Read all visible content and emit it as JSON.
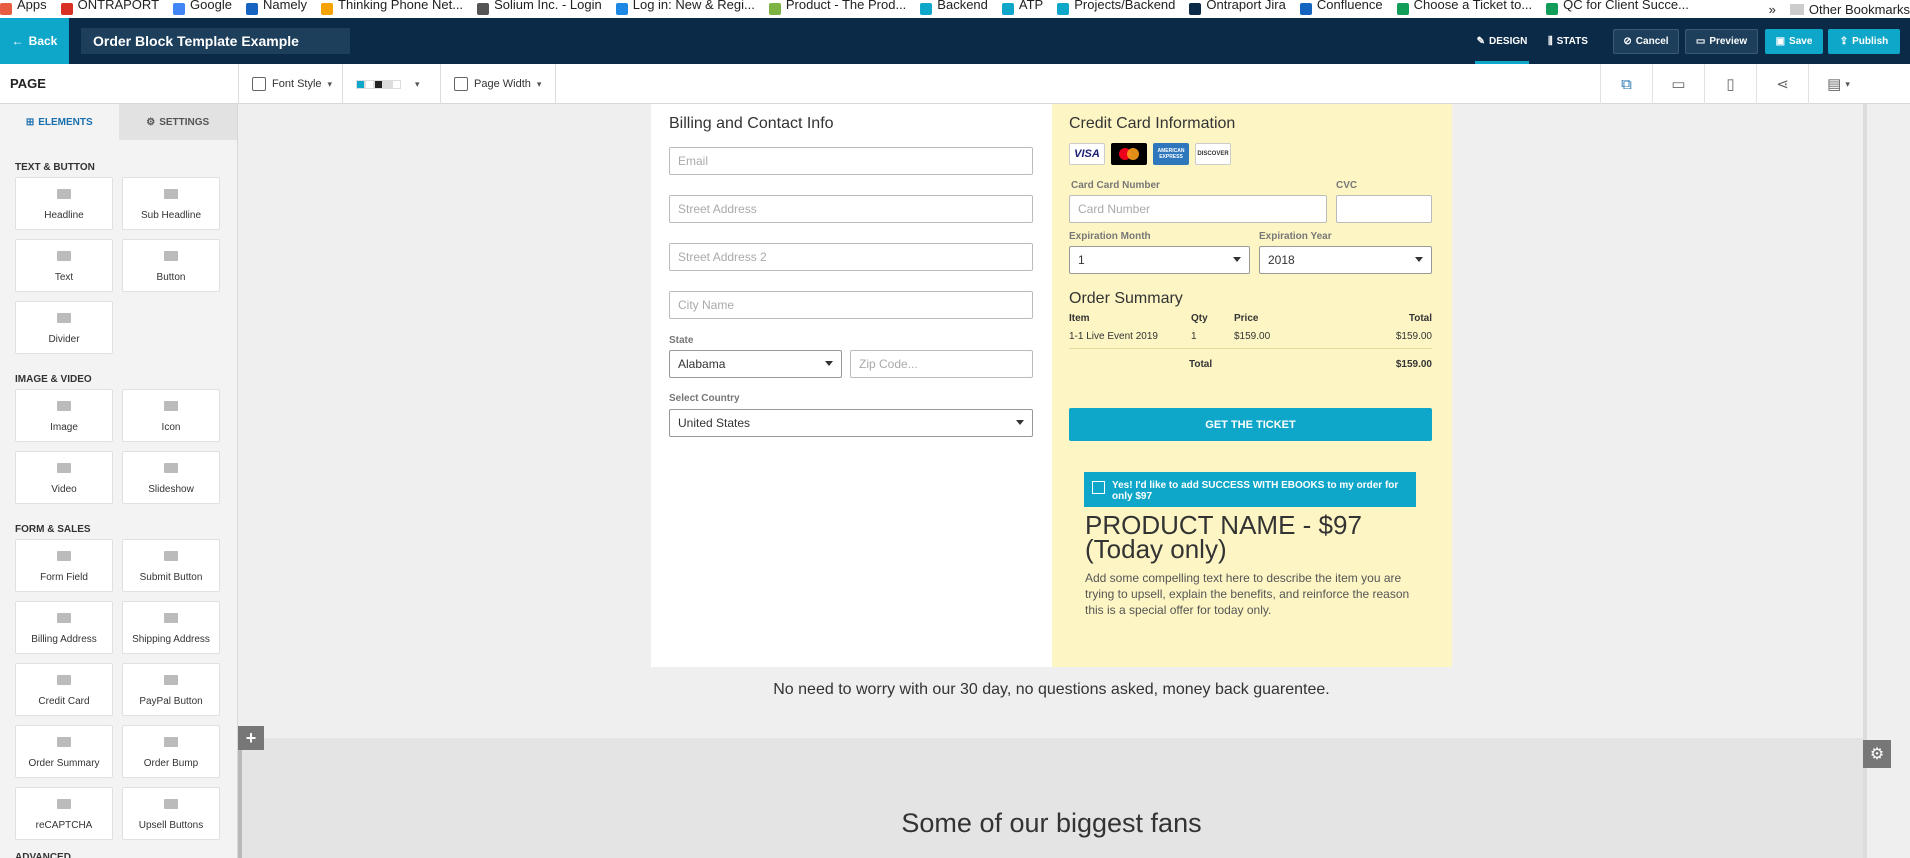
{
  "bookmarks": {
    "items": [
      {
        "label": "Apps",
        "icon": "apps-grid-icon",
        "color": "#e85c41"
      },
      {
        "label": "ONTRAPORT",
        "icon": "gmail-icon",
        "color": "#d93025"
      },
      {
        "label": "Google",
        "icon": "google-icon",
        "color": "#4285f4"
      },
      {
        "label": "Namely",
        "icon": "namely-icon",
        "color": "#1565c0"
      },
      {
        "label": "Thinking Phone Net...",
        "icon": "thinkingphone-icon",
        "color": "#f4a300"
      },
      {
        "label": "Solium Inc. - Login",
        "icon": "solium-icon",
        "color": "#555555"
      },
      {
        "label": "Log in: New & Regi...",
        "icon": "login-icon",
        "color": "#1e88e5"
      },
      {
        "label": "Product - The Prod...",
        "icon": "product-icon",
        "color": "#7cb342"
      },
      {
        "label": "Backend",
        "icon": "backend-icon",
        "color": "#0fa7c9"
      },
      {
        "label": "ATP",
        "icon": "atp-icon",
        "color": "#0fa7c9"
      },
      {
        "label": "Projects/Backend",
        "icon": "projects-icon",
        "color": "#0fa7c9"
      },
      {
        "label": "Ontraport Jira",
        "icon": "jira-icon",
        "color": "#0b2a47"
      },
      {
        "label": "Confluence",
        "icon": "confluence-icon",
        "color": "#1565c0"
      },
      {
        "label": "Choose a Ticket to...",
        "icon": "sheet-icon",
        "color": "#0f9d58"
      },
      {
        "label": "QC for Client Succe...",
        "icon": "sheet-icon",
        "color": "#0f9d58"
      }
    ],
    "more": "»",
    "other": "Other Bookmarks"
  },
  "topbar": {
    "back_label": "Back",
    "page_title": "Order Block Template Example",
    "design_label": "DESIGN",
    "stats_label": "STATS",
    "cancel_label": "Cancel",
    "preview_label": "Preview",
    "save_label": "Save",
    "publish_label": "Publish"
  },
  "toolbar": {
    "page_label": "PAGE",
    "font_style_label": "Font Style",
    "page_width_label": "Page Width",
    "swatches": [
      "#0fa7c9",
      "#ffffff",
      "#222222",
      "#dddddd",
      "#ffffff"
    ]
  },
  "sidebar": {
    "tab_elements": "ELEMENTS",
    "tab_settings": "SETTINGS",
    "sections": [
      {
        "title": "TEXT & BUTTON",
        "items": [
          "Headline",
          "Sub Headline",
          "Text",
          "Button",
          "Divider"
        ]
      },
      {
        "title": "IMAGE & VIDEO",
        "items": [
          "Image",
          "Icon",
          "Video",
          "Slideshow"
        ]
      },
      {
        "title": "FORM & SALES",
        "items": [
          "Form Field",
          "Submit Button",
          "Billing Address",
          "Shipping Address",
          "Credit Card",
          "PayPal Button",
          "Order Summary",
          "Order Bump",
          "reCAPTCHA",
          "Upsell Buttons"
        ]
      }
    ],
    "advanced_label": "ADVANCED"
  },
  "billing": {
    "heading": "Billing and Contact Info",
    "email_placeholder": "Email",
    "street_placeholder": "Street Address",
    "street2_placeholder": "Street Address 2",
    "city_placeholder": "City Name",
    "state_label": "State",
    "state_value": "Alabama",
    "zip_placeholder": "Zip Code...",
    "country_label": "Select Country",
    "country_value": "United States"
  },
  "credit_card": {
    "heading": "Credit Card Information",
    "logos": [
      "VISA",
      "mastercard",
      "AMERICAN EXPRESS",
      "DISCOVER"
    ],
    "card_number_label": "Card Card Number",
    "card_number_placeholder": "Card Number",
    "cvc_label": "CVC",
    "exp_month_label": "Expiration Month",
    "exp_month_value": "1",
    "exp_year_label": "Expiration Year",
    "exp_year_value": "2018"
  },
  "order_summary": {
    "heading": "Order Summary",
    "columns": {
      "item": "Item",
      "qty": "Qty",
      "price": "Price",
      "total": "Total"
    },
    "row": {
      "item": "1-1 Live Event 2019",
      "qty": "1",
      "price": "$159.00",
      "total": "$159.00"
    },
    "total_label": "Total",
    "total_value": "$159.00"
  },
  "cta_label": "GET THE TICKET",
  "order_bump": {
    "checkbox_text": "Yes! I'd like to add SUCCESS WITH EBOOKS to my order for only $97",
    "product_name": "PRODUCT NAME - $97 (Today only)",
    "description": "Add some compelling text here to describe the item you are trying to upsell, explain the benefits, and reinforce the reason this is a special offer for today only."
  },
  "guarantee_text": "No need to worry with our 30 day, no questions asked, money back guarentee.",
  "fans_heading": "Some of our biggest fans"
}
